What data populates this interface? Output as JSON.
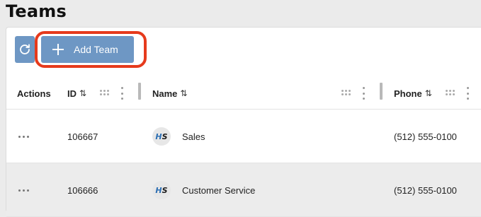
{
  "page": {
    "title": "Teams"
  },
  "toolbar": {
    "refresh_icon": "refresh-icon",
    "add_label": "Add Team",
    "add_icon": "plus-icon",
    "accent_color": "#6e97c4",
    "highlight_color": "#e63a1c"
  },
  "table": {
    "columns": {
      "actions": "Actions",
      "id": "ID",
      "name": "Name",
      "phone": "Phone"
    },
    "sort_glyph": "⇅",
    "rows": [
      {
        "id": "106667",
        "logo": {
          "h": "H",
          "s": "S"
        },
        "name": "Sales",
        "phone": "(512) 555-0100"
      },
      {
        "id": "106666",
        "logo": {
          "h": "H",
          "s": "S"
        },
        "name": "Customer Service",
        "phone": "(512) 555-0100"
      }
    ]
  }
}
